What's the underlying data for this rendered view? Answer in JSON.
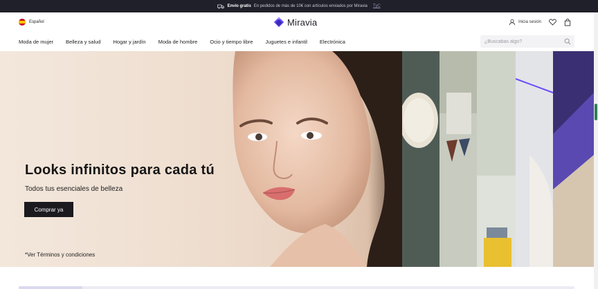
{
  "promo": {
    "icon": "truck-icon",
    "bold": "Envío gratis",
    "text": "En pedidos de más de 10€ con artículos enviados por Miravia",
    "link": "TyC"
  },
  "header": {
    "language": "Español",
    "logo_text": "Miravia",
    "login_label": "Inicia sesión"
  },
  "nav": {
    "items": [
      "Moda de mujer",
      "Belleza y salud",
      "Hogar y jardín",
      "Moda de hombre",
      "Ocio y tiempo libre",
      "Juguetes e infantil",
      "Electrónica"
    ],
    "search_placeholder": "¿Buscabas algo?"
  },
  "hero": {
    "title": "Looks infinitos para cada tú",
    "subtitle": "Todos tus esenciales de belleza",
    "cta": "Comprar ya",
    "terms": "*Ver Términos y condiciones"
  },
  "colors": {
    "promo_bg": "#1f2029",
    "brand_purple": "#6a4cff",
    "cta_bg": "#1a1a1f"
  }
}
